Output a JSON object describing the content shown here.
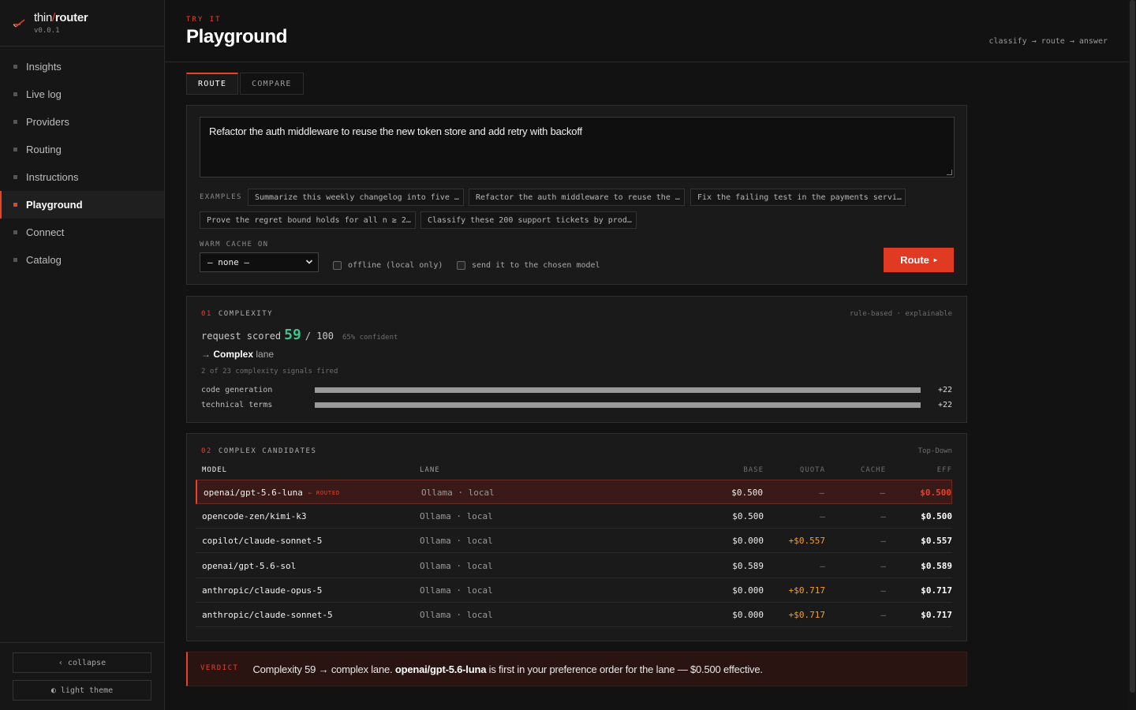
{
  "brand": {
    "name_thin": "thin",
    "name_sep": "/",
    "name_bold": "router",
    "version": "v0.0.1"
  },
  "nav": [
    {
      "label": "Insights",
      "active": false
    },
    {
      "label": "Live log",
      "active": false
    },
    {
      "label": "Providers",
      "active": false
    },
    {
      "label": "Routing",
      "active": false
    },
    {
      "label": "Instructions",
      "active": false
    },
    {
      "label": "Playground",
      "active": true
    },
    {
      "label": "Connect",
      "active": false
    },
    {
      "label": "Catalog",
      "active": false
    }
  ],
  "sidebar_bottom": {
    "collapse": "‹ collapse",
    "theme": "◐ light theme"
  },
  "header": {
    "eyebrow": "TRY IT",
    "title": "Playground",
    "flow": "classify → route → answer"
  },
  "tabs": [
    {
      "label": "ROUTE",
      "active": true
    },
    {
      "label": "COMPARE",
      "active": false
    }
  ],
  "input": {
    "prompt": "Refactor the auth middleware to reuse the new token store and add retry with backoff",
    "examples_label": "EXAMPLES",
    "examples": [
      "Summarize this weekly changelog into five …",
      "Refactor the auth middleware to reuse the …",
      "Fix the failing test in the payments servi…",
      "Prove the regret bound holds for all n ≥ 2…",
      "Classify these 200 support tickets by prod…"
    ],
    "cache_label": "WARM CACHE ON",
    "cache_value": "— none —",
    "offline_label": "offline (local only)",
    "send_label": "send it to the chosen model",
    "route_button": "Route",
    "route_arrow": "▸"
  },
  "complexity": {
    "num": "01",
    "title": "COMPLEXITY",
    "right": "rule-based · explainable",
    "prefix": "request scored",
    "score": "59",
    "max": "/ 100",
    "confidence": "65% confident",
    "arrow": "→",
    "lane_name": "Complex",
    "lane_suffix": "lane",
    "signals": "2 of 23 complexity signals fired",
    "rows": [
      {
        "name": "code generation",
        "value": "+22",
        "fill": 1.0
      },
      {
        "name": "technical terms",
        "value": "+22",
        "fill": 1.0
      }
    ]
  },
  "candidates": {
    "num": "02",
    "title": "COMPLEX CANDIDATES",
    "right": "Top-Down",
    "headers": {
      "model": "MODEL",
      "lane": "LANE",
      "base": "BASE",
      "quota": "QUOTA",
      "cache": "CACHE",
      "eff": "EFF"
    },
    "routed_tag": "← ROUTED",
    "rows": [
      {
        "model": "openai/gpt-5.6-luna",
        "lane": "Ollama · local",
        "base": "$0.500",
        "quota": "—",
        "cache": "—",
        "eff": "$0.500",
        "routed": true,
        "quota_pos": false
      },
      {
        "model": "opencode-zen/kimi-k3",
        "lane": "Ollama · local",
        "base": "$0.500",
        "quota": "—",
        "cache": "—",
        "eff": "$0.500",
        "routed": false,
        "quota_pos": false
      },
      {
        "model": "copilot/claude-sonnet-5",
        "lane": "Ollama · local",
        "base": "$0.000",
        "quota": "+$0.557",
        "cache": "—",
        "eff": "$0.557",
        "routed": false,
        "quota_pos": true
      },
      {
        "model": "openai/gpt-5.6-sol",
        "lane": "Ollama · local",
        "base": "$0.589",
        "quota": "—",
        "cache": "—",
        "eff": "$0.589",
        "routed": false,
        "quota_pos": false
      },
      {
        "model": "anthropic/claude-opus-5",
        "lane": "Ollama · local",
        "base": "$0.000",
        "quota": "+$0.717",
        "cache": "—",
        "eff": "$0.717",
        "routed": false,
        "quota_pos": true
      },
      {
        "model": "anthropic/claude-sonnet-5",
        "lane": "Ollama · local",
        "base": "$0.000",
        "quota": "+$0.717",
        "cache": "—",
        "eff": "$0.717",
        "routed": false,
        "quota_pos": true
      }
    ]
  },
  "verdict": {
    "label": "VERDICT",
    "pre": "Complexity 59 → complex lane.",
    "model": "openai/gpt-5.6-luna",
    "post": "is first in your preference order for the lane — $0.500 effective."
  },
  "colors": {
    "accent": "#e8412c",
    "score": "#3ec48a",
    "quota": "#f0a030"
  }
}
